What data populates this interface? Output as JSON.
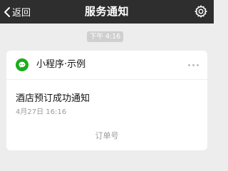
{
  "navbar": {
    "back_label": "返回",
    "title": "服务通知",
    "back_icon": "chevron-left-icon",
    "settings_icon": "gear-icon",
    "background": "#2e2e2e"
  },
  "timestamp_badge": "下午 4:16",
  "card": {
    "app_name": "小程序·示例",
    "app_icon": "chat-bubble-icon",
    "app_icon_color": "#1aad19",
    "more_icon": "more-dots-icon",
    "notice_title": "酒店预订成功通知",
    "notice_time": "4月27日 16:16",
    "field_label": "订单号"
  }
}
